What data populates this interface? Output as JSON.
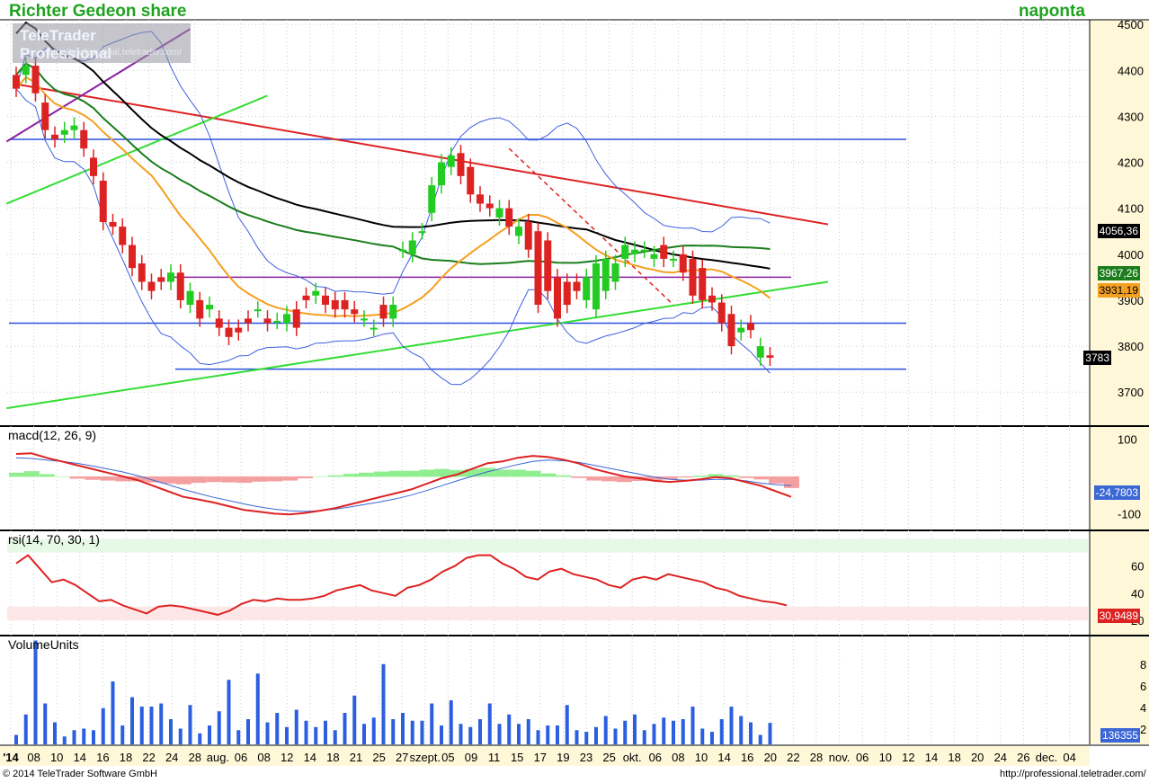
{
  "header": {
    "title": "Richter Gedeon share",
    "period": "naponta"
  },
  "watermark": {
    "brand": "TeleTrader Professional",
    "url": "http://professional.teletrader.com/"
  },
  "footer": {
    "copyright": "© 2014 TeleTrader Software GmbH",
    "url": "http://professional.teletrader.com/"
  },
  "panels": {
    "macd_label": "macd(12, 26, 9)",
    "rsi_label": "rsi(14, 70, 30, 1)",
    "volume_label": "VolumeUnits"
  },
  "tags": {
    "sma_black": "4056,36",
    "sma_green": "3967,26",
    "sma_orange": "3931,19",
    "last": "3783",
    "macd_signal": "-24,7803",
    "rsi": "30,9489",
    "volume": "136355"
  },
  "colors": {
    "title_green": "#1fa31f",
    "up": "#22cc22",
    "down": "#dd2222",
    "axis_bg": "#fff8d8",
    "grid": "#cccccc"
  },
  "chart_data": {
    "type": "candlestick",
    "dates": [
      "07-07",
      "07-08",
      "07-09",
      "07-10",
      "07-11",
      "07-14",
      "07-15",
      "07-16",
      "07-17",
      "07-18",
      "07-21",
      "07-22",
      "07-23",
      "07-24",
      "07-25",
      "07-28",
      "07-29",
      "07-30",
      "07-31",
      "08-01",
      "08-04",
      "08-05",
      "08-06",
      "08-07",
      "08-08",
      "08-11",
      "08-12",
      "08-13",
      "08-14",
      "08-15",
      "08-18",
      "08-19",
      "08-20",
      "08-21",
      "08-22",
      "08-25",
      "08-26",
      "08-27",
      "08-28",
      "08-29",
      "09-01",
      "09-02",
      "09-03",
      "09-04",
      "09-05",
      "09-08",
      "09-09",
      "09-10",
      "09-11",
      "09-12",
      "09-15",
      "09-16",
      "09-17",
      "09-18",
      "09-19",
      "09-22",
      "09-23",
      "09-24",
      "09-25",
      "09-26",
      "09-29",
      "09-30",
      "10-01",
      "10-02",
      "10-03",
      "10-06",
      "10-07",
      "10-08",
      "10-09",
      "10-10",
      "10-13",
      "10-14",
      "10-15",
      "10-16",
      "10-17",
      "10-20",
      "10-21",
      "10-22",
      "10-23"
    ],
    "open": [
      4390,
      4390,
      4410,
      4330,
      4260,
      4260,
      4270,
      4270,
      4210,
      4160,
      4070,
      4060,
      4020,
      3980,
      3940,
      3950,
      3940,
      3960,
      3890,
      3900,
      3880,
      3860,
      3840,
      3840,
      3860,
      3880,
      3860,
      3855,
      3850,
      3880,
      3910,
      3910,
      3910,
      3900,
      3900,
      3880,
      3860,
      3840,
      3890,
      3860,
      4010,
      4000,
      4050,
      4090,
      4150,
      4190,
      4220,
      4190,
      4130,
      4110,
      4080,
      4100,
      4040,
      4070,
      4050,
      4030,
      3950,
      3940,
      3940,
      3900,
      3880,
      3920,
      3940,
      3990,
      4000,
      4010,
      3990,
      4020,
      3990,
      4000,
      3990,
      3970,
      3910,
      3895,
      3870,
      3830,
      3850,
      3775,
      3780
    ],
    "close": [
      4360,
      4410,
      4350,
      4270,
      4250,
      4270,
      4280,
      4230,
      4170,
      4070,
      4060,
      4020,
      3970,
      3940,
      3920,
      3940,
      3960,
      3900,
      3920,
      3860,
      3890,
      3840,
      3820,
      3830,
      3850,
      3880,
      3850,
      3855,
      3870,
      3840,
      3900,
      3920,
      3890,
      3880,
      3880,
      3870,
      3860,
      3840,
      3860,
      3890,
      4010,
      4030,
      4050,
      4150,
      4200,
      4215,
      4170,
      4130,
      4110,
      4100,
      4100,
      4060,
      4060,
      4010,
      3890,
      3920,
      3860,
      3890,
      3920,
      3950,
      3980,
      3990,
      3980,
      4020,
      4010,
      4010,
      4000,
      3990,
      3990,
      3960,
      3910,
      3900,
      3895,
      3850,
      3800,
      3840,
      3835,
      3800,
      3775
    ],
    "volume": [
      60000,
      190000,
      660000,
      260000,
      140000,
      50000,
      90000,
      100000,
      90000,
      230000,
      400000,
      120000,
      300000,
      240000,
      240000,
      260000,
      160000,
      100000,
      250000,
      70000,
      120000,
      210000,
      410000,
      90000,
      160000,
      450000,
      140000,
      200000,
      110000,
      220000,
      150000,
      110000,
      150000,
      90000,
      200000,
      310000,
      130000,
      170000,
      510000,
      160000,
      200000,
      150000,
      150000,
      260000,
      120000,
      280000,
      130000,
      110000,
      160000,
      260000,
      130000,
      190000,
      130000,
      160000,
      90000,
      120000,
      120000,
      250000,
      90000,
      80000,
      110000,
      180000,
      100000,
      150000,
      190000,
      90000,
      130000,
      170000,
      150000,
      160000,
      240000,
      100000,
      80000,
      160000,
      240000,
      180000,
      140000,
      60000,
      136355
    ],
    "price_axis": {
      "min": 3630,
      "max": 4510,
      "ticks": [
        3700,
        3800,
        3900,
        4000,
        4100,
        4200,
        4300,
        4400,
        4500
      ]
    },
    "macd_axis": {
      "min": -140,
      "max": 130,
      "ticks": [
        100,
        -100
      ]
    },
    "rsi_axis": {
      "min": 10,
      "max": 85,
      "ticks": [
        20,
        40,
        60
      ]
    },
    "volume_axis_ticks": [
      "2",
      "4",
      "6",
      "8"
    ],
    "x_tick_labels": [
      "'14",
      "08",
      "10",
      "14",
      "16",
      "18",
      "22",
      "24",
      "28",
      "aug.",
      "06",
      "08",
      "12",
      "14",
      "18",
      "21",
      "25",
      "27",
      "szept.",
      "05",
      "09",
      "11",
      "15",
      "17",
      "19",
      "23",
      "25",
      "okt.",
      "06",
      "08",
      "10",
      "14",
      "16",
      "20",
      "22",
      "28",
      "nov.",
      "06",
      "10",
      "12",
      "14",
      "18",
      "20",
      "24",
      "26",
      "dec.",
      "04"
    ],
    "horizontal_levels": [
      4250,
      3950,
      3850,
      3750
    ],
    "macd_line": [
      60,
      62,
      50,
      40,
      30,
      20,
      10,
      0,
      -10,
      -25,
      -40,
      -55,
      -62,
      -70,
      -80,
      -90,
      -95,
      -100,
      -102,
      -98,
      -92,
      -85,
      -75,
      -65,
      -55,
      -45,
      -35,
      -20,
      -5,
      5,
      20,
      35,
      40,
      50,
      55,
      52,
      45,
      35,
      20,
      10,
      0,
      -5,
      -12,
      -15,
      -12,
      -8,
      -2,
      -5,
      -15,
      -25,
      -40,
      -55
    ],
    "macd_signal": [
      50,
      48,
      44,
      40,
      35,
      28,
      20,
      12,
      2,
      -10,
      -22,
      -35,
      -46,
      -56,
      -65,
      -74,
      -82,
      -88,
      -92,
      -94,
      -92,
      -88,
      -82,
      -75,
      -68,
      -60,
      -50,
      -38,
      -25,
      -12,
      0,
      12,
      22,
      32,
      40,
      44,
      42,
      38,
      30,
      22,
      14,
      6,
      -2,
      -8,
      -10,
      -10,
      -8,
      -8,
      -12,
      -18,
      -22,
      -25
    ],
    "rsi": [
      62,
      68,
      58,
      48,
      50,
      46,
      40,
      34,
      35,
      31,
      28,
      25,
      30,
      31,
      30,
      28,
      26,
      24,
      27,
      32,
      35,
      34,
      36,
      35,
      35,
      36,
      38,
      42,
      44,
      46,
      42,
      40,
      38,
      44,
      46,
      50,
      56,
      60,
      66,
      68,
      68,
      62,
      58,
      52,
      50,
      56,
      58,
      54,
      52,
      50,
      46,
      44,
      50,
      52,
      50,
      54,
      52,
      50,
      48,
      44,
      42,
      38,
      36,
      34,
      33,
      31
    ]
  }
}
